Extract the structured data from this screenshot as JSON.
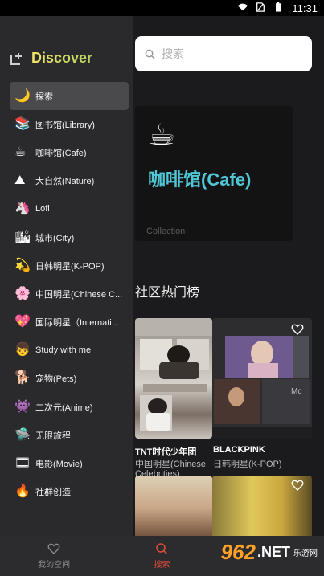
{
  "status_bar": {
    "time": "11:31"
  },
  "brand": {
    "title": "Discover"
  },
  "sidebar": {
    "items": [
      {
        "emoji": "🌙",
        "label": "探索"
      },
      {
        "emoji": "📚",
        "label": "图书馆(Library)"
      },
      {
        "emoji": "☕",
        "label": "咖啡馆(Cafe)"
      },
      {
        "emoji": "⛰",
        "label": "大自然(Nature)"
      },
      {
        "emoji": "🦄",
        "label": "Lofi"
      },
      {
        "emoji": "🏙",
        "label": "城市(City)"
      },
      {
        "emoji": "💫",
        "label": "日韩明星(K-POP)"
      },
      {
        "emoji": "🌸",
        "label": "中国明星(Chinese C..."
      },
      {
        "emoji": "💖",
        "label": "国际明星（Internati..."
      },
      {
        "emoji": "👦",
        "label": "Study with me"
      },
      {
        "emoji": "🐕",
        "label": "宠物(Pets)"
      },
      {
        "emoji": "👾",
        "label": "二次元(Anime)"
      },
      {
        "emoji": "🛸",
        "label": "无限旅程"
      },
      {
        "emoji": "🎞",
        "label": "电影(Movie)"
      },
      {
        "emoji": "🔥",
        "label": "社群创造"
      }
    ]
  },
  "search": {
    "placeholder": "搜索"
  },
  "feature": {
    "emoji": "☕",
    "title": "咖啡馆(Cafe)",
    "subtitle": "Collection"
  },
  "section": {
    "title": "社区热门榜"
  },
  "cards": [
    {
      "title": "TNT时代少年团",
      "subtitle": "中国明星(Chinese",
      "subtitle2": "Celebrities)"
    },
    {
      "title": "BLACKPINK",
      "subtitle": "日韩明星(K-POP)",
      "overlay_text": "Mc"
    }
  ],
  "tabs": [
    {
      "label": "我的空间"
    },
    {
      "label": "搜索"
    }
  ],
  "watermark": {
    "number": "962",
    "suffix": ".NET",
    "site": "乐游网"
  },
  "colors": {
    "accent": "#d94b3b",
    "feature_title": "#4fc7d6",
    "watermark": "#ffa126"
  }
}
